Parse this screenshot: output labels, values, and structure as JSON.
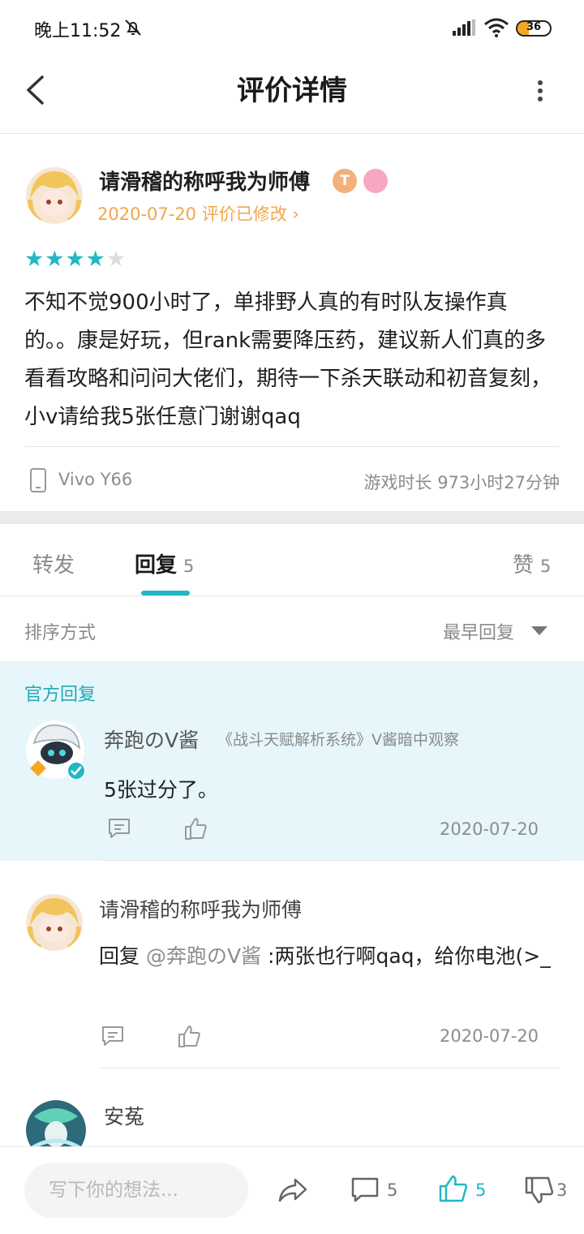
{
  "status_bar": {
    "time": "晚上11:52",
    "battery": "36",
    "battery_level": 0.36
  },
  "app_bar": {
    "title": "评价详情"
  },
  "review": {
    "author": "请滑稽的称呼我为师傅",
    "badge_letter": "T",
    "date_line": "2020-07-20 评价已修改",
    "rating": 4,
    "rating_max": 5,
    "text": "不知不觉900小时了，单排野人真的有时队友操作真的。。康是好玩，但rank需要降压药，建议新人们真的多看看攻略和问问大佬们，期待一下杀天联动和初音复刻，小v请给我5张任意门谢谢qaq",
    "device": "Vivo Y66",
    "playtime": "游戏时长 973小时27分钟"
  },
  "tabs": [
    {
      "label": "转发"
    },
    {
      "label": "回复",
      "count": "5"
    },
    {
      "label": "赞",
      "count": "5"
    }
  ],
  "sort": {
    "label": "排序方式",
    "value": "最早回复"
  },
  "official_reply": {
    "section_label": "官方回复",
    "name": "奔跑のV酱",
    "title": "《战斗天赋解析系统》V酱暗中观察",
    "text": "5张过分了。",
    "date": "2020-07-20"
  },
  "replies": [
    {
      "name": "请滑稽的称呼我为师傅",
      "prefix": "回复",
      "mention": "@奔跑のV酱",
      "text": ":两张也行啊qaq，给你电池(>_",
      "date": "2020-07-20"
    },
    {
      "name": "安菟"
    }
  ],
  "bottom_bar": {
    "placeholder": "写下你的想法...",
    "comments": "5",
    "likes": "5",
    "dislikes": "3"
  },
  "colors": {
    "accent": "#21b8c4",
    "orange": "#f0a64a",
    "official_bg": "#e6f6fa"
  }
}
